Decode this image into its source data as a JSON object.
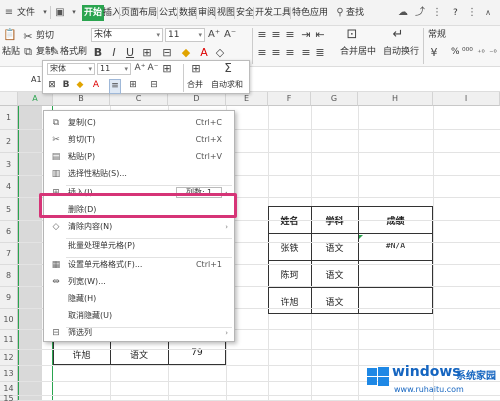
{
  "menubar": {
    "file_label": "文件",
    "tabs": [
      "开始",
      "插入",
      "页面布局",
      "公式",
      "数据",
      "审阅",
      "视图",
      "安全",
      "开发工具",
      "特色应用"
    ],
    "search_label": "查找",
    "help_label": "?"
  },
  "ribbon": {
    "paste_label": "粘贴",
    "cut_label": "剪切",
    "copy_label": "复制",
    "format_painter_label": "格式刷",
    "font_name": "宋体",
    "font_size": "11",
    "merge_center_label": "合并居中",
    "wrap_label": "自动换行",
    "number_format": "常规",
    "percent_label": "%"
  },
  "minitoolbar": {
    "font_name": "宋体",
    "font_size": "11",
    "merge_label": "合并",
    "autosum_label": "自动求和"
  },
  "namebox": "A1",
  "columns": [
    "A",
    "B",
    "C",
    "D",
    "E",
    "F",
    "G",
    "H",
    "I"
  ],
  "rows": [
    "1",
    "2",
    "3",
    "4",
    "5",
    "6",
    "7",
    "8",
    "9",
    "10",
    "11",
    "12",
    "13",
    "14",
    "15"
  ],
  "context_menu": {
    "items": [
      {
        "label": "复制(C)",
        "shortcut": "Ctrl+C"
      },
      {
        "label": "剪切(T)",
        "shortcut": "Ctrl+X"
      },
      {
        "label": "粘贴(P)",
        "shortcut": "Ctrl+V"
      },
      {
        "label": "选择性粘贴(S)...",
        "shortcut": ""
      },
      {
        "label": "插入(I)",
        "shortcut": ""
      },
      {
        "label": "删除(D)",
        "shortcut": ""
      },
      {
        "label": "清除内容(N)",
        "shortcut": ""
      },
      {
        "label": "批量处理单元格(P)",
        "shortcut": ""
      },
      {
        "label": "设置单元格格式(F)...",
        "shortcut": "Ctrl+1"
      },
      {
        "label": "列宽(W)...",
        "shortcut": ""
      },
      {
        "label": "隐藏(H)",
        "shortcut": ""
      },
      {
        "label": "取消隐藏(U)",
        "shortcut": ""
      },
      {
        "label": "筛选列",
        "shortcut": ""
      }
    ],
    "insert_cols_label": "列数:",
    "insert_cols_value": "1"
  },
  "table": {
    "headers": [
      "姓名",
      "学科",
      "成绩"
    ],
    "rows": [
      [
        "张铁",
        "语文",
        "#N/A"
      ],
      [
        "陈珂",
        "语文",
        ""
      ],
      [
        "许旭",
        "语文",
        ""
      ]
    ]
  },
  "lower_row": [
    "许旭",
    "语文",
    "79"
  ],
  "watermark": {
    "brand": "windows",
    "suffix": "系统家园",
    "url": "www.ruhaitu.com"
  },
  "colors": {
    "accent": "#2aa44f",
    "highlight": "#d63477",
    "selection": "#2aa44f"
  }
}
